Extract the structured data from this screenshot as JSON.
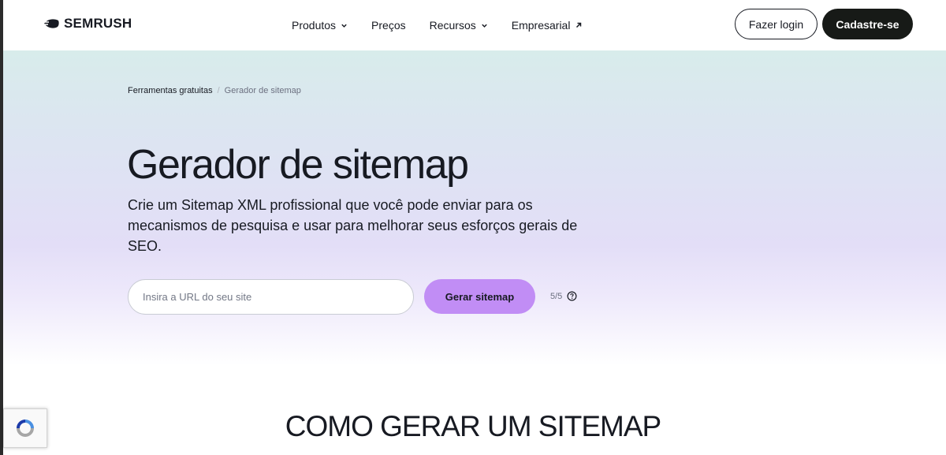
{
  "header": {
    "brand": "SEMRUSH",
    "nav": [
      {
        "label": "Produtos",
        "icon": "chevron-down-icon"
      },
      {
        "label": "Preços"
      },
      {
        "label": "Recursos",
        "icon": "chevron-down-icon"
      },
      {
        "label": "Empresarial",
        "icon": "external-arrow-icon"
      }
    ],
    "login_label": "Fazer login",
    "signup_label": "Cadastre-se"
  },
  "breadcrumb": {
    "parent": "Ferramentas gratuitas",
    "separator": "/",
    "current": "Gerador de sitemap"
  },
  "hero": {
    "title": "Gerador de sitemap",
    "subtitle": "Crie um Sitemap XML profissional que você pode enviar para os mecanismos de pesquisa e usar para melhorar seus esforços gerais de SEO.",
    "input_placeholder": "Insira a URL do seu site",
    "input_value": "",
    "generate_label": "Gerar sitemap",
    "limit": "5/5"
  },
  "section": {
    "title": "COMO GERAR UM SITEMAP"
  },
  "colors": {
    "accent": "#c18df5",
    "dark": "#171a17"
  }
}
